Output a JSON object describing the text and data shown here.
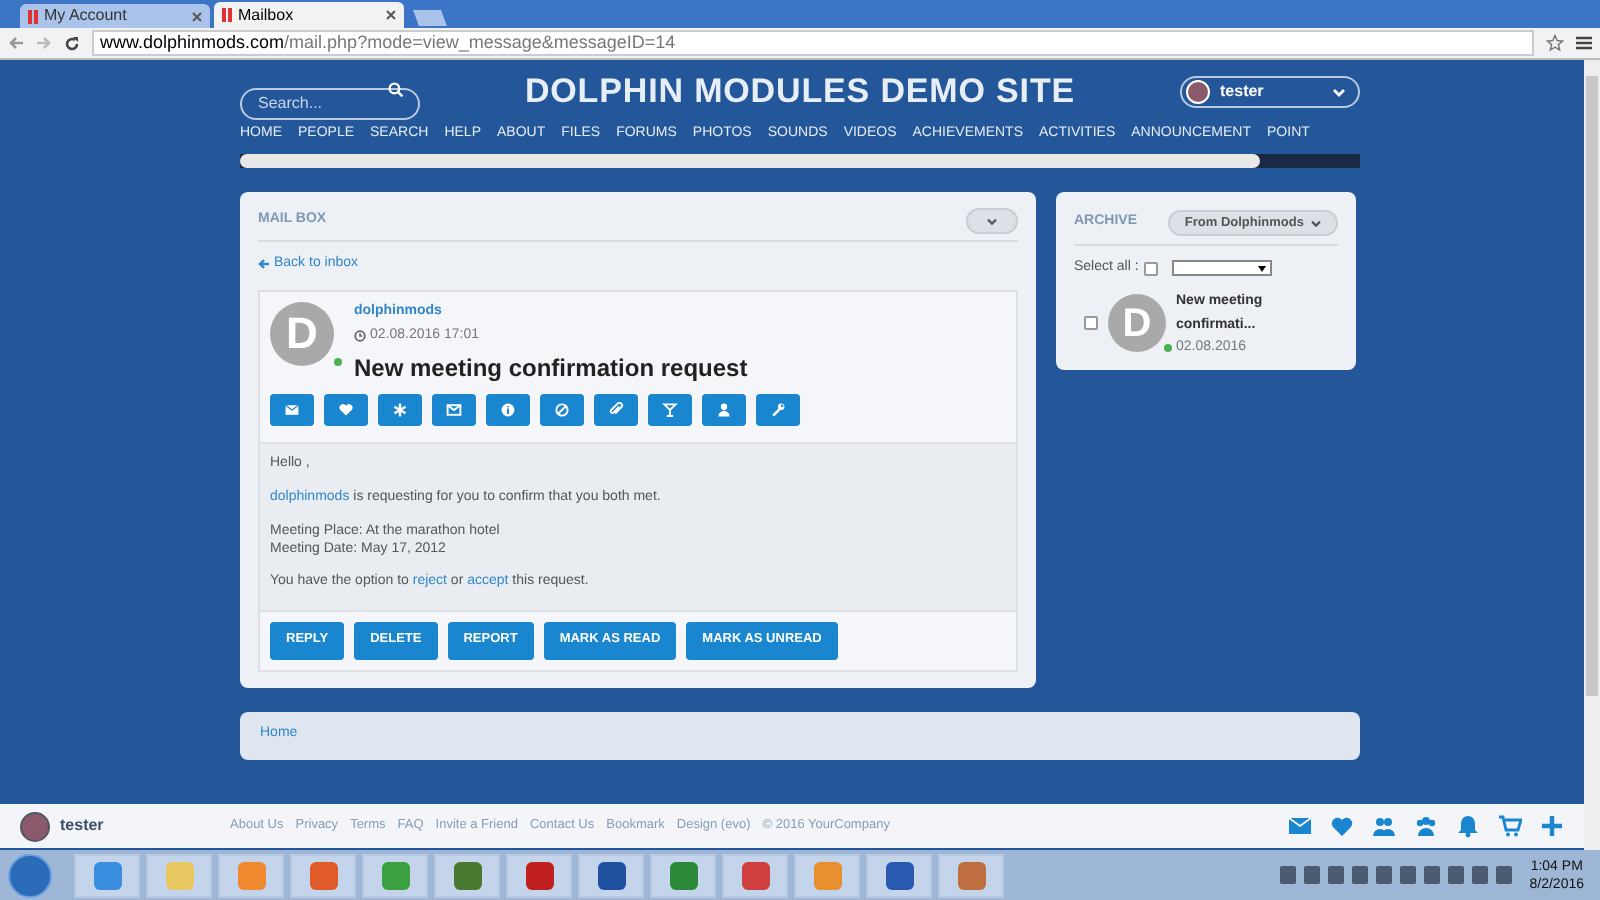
{
  "browser": {
    "tabs": [
      {
        "label": "My Account",
        "selected": false
      },
      {
        "label": "Mailbox",
        "selected": true
      }
    ],
    "url_host": "www.dolphinmods.com",
    "url_path": "/mail.php?mode=view_message&messageID=14"
  },
  "header": {
    "search": {
      "placeholder": "Search..."
    },
    "site_title": "DOLPHIN MODULES DEMO SITE",
    "user": "tester"
  },
  "nav": [
    "HOME",
    "PEOPLE",
    "SEARCH",
    "HELP",
    "ABOUT",
    "FILES",
    "FORUMS",
    "PHOTOS",
    "SOUNDS",
    "VIDEOS",
    "ACHIEVEMENTS",
    "ACTIVITIES",
    "ANNOUNCEMENT",
    "POINT"
  ],
  "mailbox": {
    "title": "MAIL BOX",
    "back": "Back to inbox",
    "avatar_letter": "D",
    "online": true,
    "sender": "dolphinmods",
    "date": "02.08.2016 17:01",
    "subject": "New meeting confirmation request",
    "body": {
      "greeting": "Hello ,",
      "line1_link": "dolphinmods",
      "line1_rest": "is requesting for you to confirm that you both met.",
      "place": "Meeting Place: At the marathon hotel",
      "date_line": "Meeting Date: May 17, 2012",
      "option_pre": "You have the option to",
      "reject": "reject",
      "option_mid": "or",
      "accept": "accept",
      "option_post": "this request."
    },
    "actions": [
      "REPLY",
      "DELETE",
      "REPORT",
      "MARK AS READ",
      "MARK AS UNREAD"
    ]
  },
  "archive": {
    "title": "ARCHIVE",
    "filter": "From Dolphinmods",
    "select_all": "Select all :",
    "select_all_checked": false,
    "items": [
      {
        "avatar_letter": "D",
        "online": true,
        "checked": false,
        "subject": "New meeting confirmati...",
        "date": "02.08.2016"
      }
    ]
  },
  "breadcrumb": "Home",
  "footer_links": [
    "About Us",
    "Privacy",
    "Terms",
    "FAQ",
    "Invite a Friend",
    "Contact Us",
    "Bookmark",
    "Design (evo)",
    "© 2016 YourCompany"
  ],
  "bottom_bar": {
    "user": "tester"
  },
  "taskbar": {
    "time": "1:04 PM",
    "date": "8/2/2016"
  }
}
